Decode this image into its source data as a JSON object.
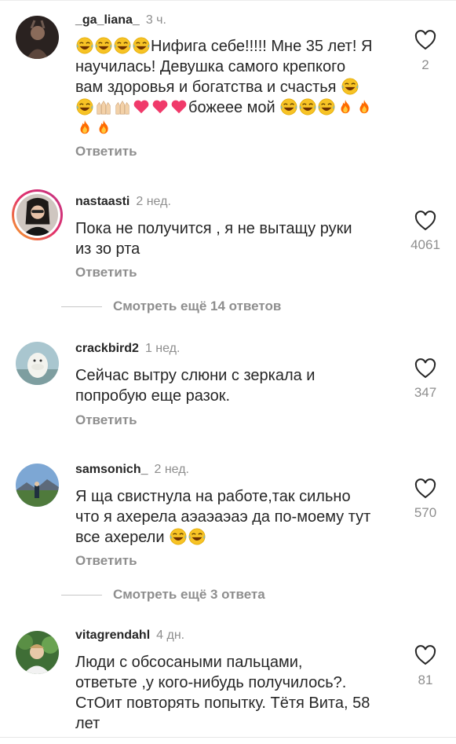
{
  "comments": [
    {
      "username": "_ga_liana_",
      "time": "3 ч.",
      "lines": [
        "😂😂😂😂Нифига себе!!!!! Мне 35 лет! Я",
        "научилась! Девушка самого крепкого",
        "вам здоровья и богатства и счастья 😂",
        "😂🙌🏻🙌🏻❤️❤️❤️божеее мой 😂😂😂🔥🔥",
        "🔥🔥"
      ],
      "text_plain_1": "Нифига себе!!!!! Мне 35 лет! Я",
      "text_plain_2": "научилась! Девушка самого крепкого",
      "text_plain_3": "вам здоровья и богатства и счастья",
      "text_plain_4": "божеее мой",
      "likes": "2",
      "reply": "Ответить"
    },
    {
      "username": "nastaasti",
      "time": "2 нед.",
      "text1": "Пока не получится , я не вытащу руки",
      "text2": "из зо рта",
      "likes": "4061",
      "reply": "Ответить"
    },
    {
      "username": "crackbird2",
      "time": "1 нед.",
      "text1": "Сейчас вытру слюни с зеркала и",
      "text2": "попробую еще разок.",
      "likes": "347",
      "reply": "Ответить"
    },
    {
      "username": "samsonich_",
      "time": "2 нед.",
      "text1": "Я ща свистнула на работе,так сильно",
      "text2": "что я ахерела аэаэаэаэ да по-моему тут",
      "text3": "все ахерели",
      "likes": "570",
      "reply": "Ответить"
    },
    {
      "username": "vitagrendahl",
      "time": "4 дн.",
      "text1": "Люди с обсосаными пальцами,",
      "text2": "ответьте ,у кого-нибудь получилось?.",
      "text3": "СтОит повторять попытку. Тётя Вита, 58",
      "text4": "лет",
      "likes": "81"
    }
  ],
  "more_replies": [
    "Смотреть ещё 14 ответов",
    "Смотреть ещё 3 ответа"
  ],
  "icons": {
    "like": "heart-outline-icon",
    "laugh": "tears-of-joy-emoji",
    "heart": "red-heart-emoji",
    "fire": "fire-emoji",
    "hands": "raised-hands-emoji"
  },
  "colors": {
    "text": "#262626",
    "muted": "#8e8e8e",
    "divider": "#c7c7c7"
  }
}
